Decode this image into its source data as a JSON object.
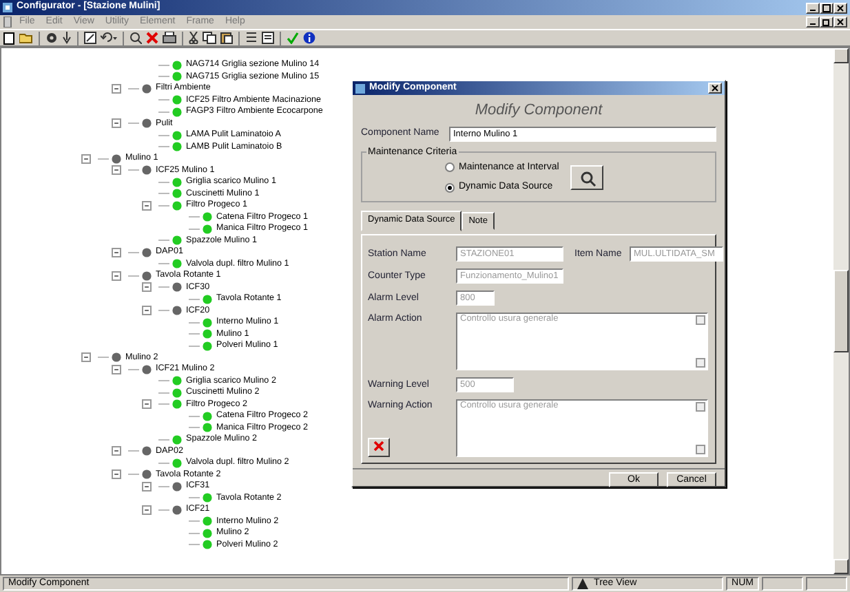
{
  "window": {
    "title": "Configurator - [Stazione Mulini]",
    "menu": [
      "File",
      "Edit",
      "View",
      "Utility",
      "Element",
      "Frame",
      "Help"
    ]
  },
  "tree": {
    "items": [
      {
        "children": [
          {
            "children": [
              {
                "label": "NAG714 Griglia sezione Mulino 14",
                "kind": "leaf"
              },
              {
                "label": "NAG715 Griglia sezione Mulino 15",
                "kind": "leaf"
              }
            ]
          },
          {
            "label": "Filtri Ambiente",
            "kind": "group",
            "expanded": true,
            "children": [
              {
                "label": "ICF25 Filtro Ambiente Macinazione",
                "kind": "leaf"
              },
              {
                "label": "FAGP3 Filtro Ambiente Ecocarpone",
                "kind": "leaf"
              }
            ]
          },
          {
            "label": "Pulit",
            "kind": "group",
            "expanded": true,
            "children": [
              {
                "label": "LAMA Pulit Laminatoio A",
                "kind": "leaf"
              },
              {
                "label": "LAMB Pulit Laminatoio B",
                "kind": "leaf"
              }
            ]
          }
        ]
      },
      {
        "label": "Mulino 1",
        "kind": "group",
        "expanded": true,
        "children": [
          {
            "label": "ICF25 Mulino 1",
            "kind": "group",
            "expanded": true,
            "children": [
              {
                "label": "Griglia scarico Mulino 1",
                "kind": "leaf"
              },
              {
                "label": "Cuscinetti Mulino 1",
                "kind": "leaf"
              },
              {
                "label": "Filtro Progeco 1",
                "kind": "leaf",
                "expanded": true,
                "children": [
                  {
                    "label": "Catena Filtro Progeco 1",
                    "kind": "leaf"
                  },
                  {
                    "label": "Manica Filtro Progeco 1",
                    "kind": "leaf"
                  }
                ]
              },
              {
                "label": "Spazzole Mulino 1",
                "kind": "leaf"
              }
            ]
          },
          {
            "label": "DAP01",
            "kind": "group",
            "expanded": true,
            "children": [
              {
                "label": "Valvola dupl. filtro Mulino 1",
                "kind": "leaf"
              }
            ]
          },
          {
            "label": "Tavola Rotante 1",
            "kind": "group",
            "expanded": true,
            "children": [
              {
                "label": "ICF30",
                "kind": "group",
                "expanded": true,
                "children": [
                  {
                    "label": "Tavola Rotante 1",
                    "kind": "leaf"
                  }
                ]
              },
              {
                "label": "ICF20",
                "kind": "group",
                "expanded": true,
                "children": [
                  {
                    "label": "Interno Mulino 1",
                    "kind": "leaf"
                  },
                  {
                    "label": "Mulino 1",
                    "kind": "leaf"
                  },
                  {
                    "label": "Polveri Mulino 1",
                    "kind": "leaf"
                  }
                ]
              }
            ]
          }
        ]
      },
      {
        "label": "Mulino 2",
        "kind": "group",
        "expanded": true,
        "children": [
          {
            "label": "ICF21 Mulino 2",
            "kind": "group",
            "expanded": true,
            "children": [
              {
                "label": "Griglia scarico Mulino 2",
                "kind": "leaf"
              },
              {
                "label": "Cuscinetti Mulino 2",
                "kind": "leaf"
              },
              {
                "label": "Filtro Progeco 2",
                "kind": "leaf",
                "expanded": true,
                "children": [
                  {
                    "label": "Catena Filtro Progeco 2",
                    "kind": "leaf"
                  },
                  {
                    "label": "Manica Filtro Progeco 2",
                    "kind": "leaf"
                  }
                ]
              },
              {
                "label": "Spazzole Mulino 2",
                "kind": "leaf"
              }
            ]
          },
          {
            "label": "DAP02",
            "kind": "group",
            "expanded": true,
            "children": [
              {
                "label": "Valvola dupl. filtro Mulino 2",
                "kind": "leaf"
              }
            ]
          },
          {
            "label": "Tavola Rotante 2",
            "kind": "group",
            "expanded": true,
            "children": [
              {
                "label": "ICF31",
                "kind": "group",
                "expanded": true,
                "children": [
                  {
                    "label": "Tavola Rotante 2",
                    "kind": "leaf"
                  }
                ]
              },
              {
                "label": "ICF21",
                "kind": "group",
                "expanded": true,
                "children": [
                  {
                    "label": "Interno Mulino 2",
                    "kind": "leaf"
                  },
                  {
                    "label": "Mulino 2",
                    "kind": "leaf"
                  },
                  {
                    "label": "Polveri Mulino 2",
                    "kind": "leaf"
                  }
                ]
              }
            ]
          }
        ]
      }
    ]
  },
  "dialog": {
    "title": "Modify Component",
    "heading": "Modify Component",
    "component_name": {
      "label": "Component Name",
      "value": "Interno Mulino 1",
      "disabled": false
    },
    "criteria": {
      "legend": "Maintenance Criteria",
      "options": [
        {
          "label": "Maintenance at Interval",
          "selected": false
        },
        {
          "label": "Dynamic Data Source",
          "selected": true
        }
      ]
    },
    "tabs": [
      {
        "label": "Dynamic Data Source",
        "selected": true
      },
      {
        "label": "Note",
        "selected": false
      }
    ],
    "station_name": {
      "label": "Station Name",
      "value": "STAZIONE01",
      "disabled": true
    },
    "item_name": {
      "label": "Item Name",
      "value": "MUL.ULTIDATA_SM",
      "disabled": true
    },
    "counter_type": {
      "label": "Counter Type",
      "value": "Funzionamento_Mulino1",
      "disabled": true
    },
    "alarm_level": {
      "label": "Alarm Level",
      "value": "800",
      "disabled": true
    },
    "alarm_action": {
      "label": "Alarm Action",
      "value": "Controllo usura generale",
      "disabled": true
    },
    "warning_level": {
      "label": "Warning Level",
      "value": "500",
      "disabled": true
    },
    "warning_action": {
      "label": "Warning Action",
      "value": "Controllo usura generale",
      "disabled": true
    },
    "buttons": [
      "Ok",
      "Cancel"
    ]
  },
  "status_bar": {
    "message": "Modify Component",
    "view": "Tree View",
    "panes": [
      "NUM"
    ]
  }
}
